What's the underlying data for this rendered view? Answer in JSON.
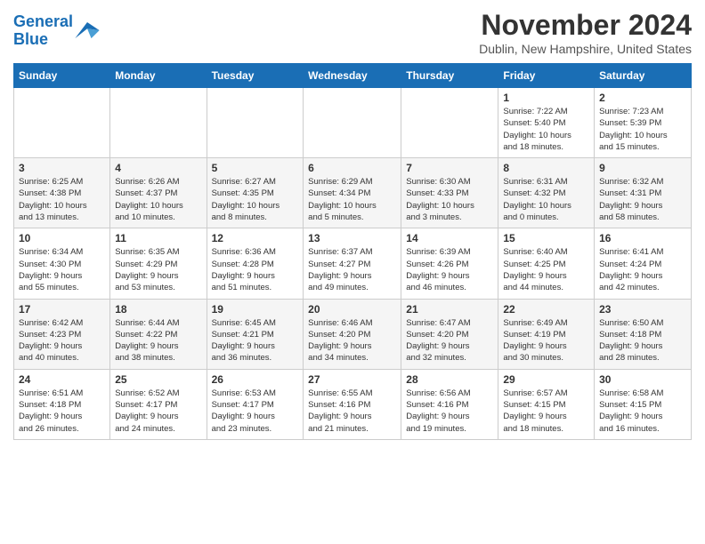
{
  "logo": {
    "line1": "General",
    "line2": "Blue"
  },
  "title": "November 2024",
  "location": "Dublin, New Hampshire, United States",
  "days_header": [
    "Sunday",
    "Monday",
    "Tuesday",
    "Wednesday",
    "Thursday",
    "Friday",
    "Saturday"
  ],
  "weeks": [
    [
      {
        "day": "",
        "info": ""
      },
      {
        "day": "",
        "info": ""
      },
      {
        "day": "",
        "info": ""
      },
      {
        "day": "",
        "info": ""
      },
      {
        "day": "",
        "info": ""
      },
      {
        "day": "1",
        "info": "Sunrise: 7:22 AM\nSunset: 5:40 PM\nDaylight: 10 hours\nand 18 minutes."
      },
      {
        "day": "2",
        "info": "Sunrise: 7:23 AM\nSunset: 5:39 PM\nDaylight: 10 hours\nand 15 minutes."
      }
    ],
    [
      {
        "day": "3",
        "info": "Sunrise: 6:25 AM\nSunset: 4:38 PM\nDaylight: 10 hours\nand 13 minutes."
      },
      {
        "day": "4",
        "info": "Sunrise: 6:26 AM\nSunset: 4:37 PM\nDaylight: 10 hours\nand 10 minutes."
      },
      {
        "day": "5",
        "info": "Sunrise: 6:27 AM\nSunset: 4:35 PM\nDaylight: 10 hours\nand 8 minutes."
      },
      {
        "day": "6",
        "info": "Sunrise: 6:29 AM\nSunset: 4:34 PM\nDaylight: 10 hours\nand 5 minutes."
      },
      {
        "day": "7",
        "info": "Sunrise: 6:30 AM\nSunset: 4:33 PM\nDaylight: 10 hours\nand 3 minutes."
      },
      {
        "day": "8",
        "info": "Sunrise: 6:31 AM\nSunset: 4:32 PM\nDaylight: 10 hours\nand 0 minutes."
      },
      {
        "day": "9",
        "info": "Sunrise: 6:32 AM\nSunset: 4:31 PM\nDaylight: 9 hours\nand 58 minutes."
      }
    ],
    [
      {
        "day": "10",
        "info": "Sunrise: 6:34 AM\nSunset: 4:30 PM\nDaylight: 9 hours\nand 55 minutes."
      },
      {
        "day": "11",
        "info": "Sunrise: 6:35 AM\nSunset: 4:29 PM\nDaylight: 9 hours\nand 53 minutes."
      },
      {
        "day": "12",
        "info": "Sunrise: 6:36 AM\nSunset: 4:28 PM\nDaylight: 9 hours\nand 51 minutes."
      },
      {
        "day": "13",
        "info": "Sunrise: 6:37 AM\nSunset: 4:27 PM\nDaylight: 9 hours\nand 49 minutes."
      },
      {
        "day": "14",
        "info": "Sunrise: 6:39 AM\nSunset: 4:26 PM\nDaylight: 9 hours\nand 46 minutes."
      },
      {
        "day": "15",
        "info": "Sunrise: 6:40 AM\nSunset: 4:25 PM\nDaylight: 9 hours\nand 44 minutes."
      },
      {
        "day": "16",
        "info": "Sunrise: 6:41 AM\nSunset: 4:24 PM\nDaylight: 9 hours\nand 42 minutes."
      }
    ],
    [
      {
        "day": "17",
        "info": "Sunrise: 6:42 AM\nSunset: 4:23 PM\nDaylight: 9 hours\nand 40 minutes."
      },
      {
        "day": "18",
        "info": "Sunrise: 6:44 AM\nSunset: 4:22 PM\nDaylight: 9 hours\nand 38 minutes."
      },
      {
        "day": "19",
        "info": "Sunrise: 6:45 AM\nSunset: 4:21 PM\nDaylight: 9 hours\nand 36 minutes."
      },
      {
        "day": "20",
        "info": "Sunrise: 6:46 AM\nSunset: 4:20 PM\nDaylight: 9 hours\nand 34 minutes."
      },
      {
        "day": "21",
        "info": "Sunrise: 6:47 AM\nSunset: 4:20 PM\nDaylight: 9 hours\nand 32 minutes."
      },
      {
        "day": "22",
        "info": "Sunrise: 6:49 AM\nSunset: 4:19 PM\nDaylight: 9 hours\nand 30 minutes."
      },
      {
        "day": "23",
        "info": "Sunrise: 6:50 AM\nSunset: 4:18 PM\nDaylight: 9 hours\nand 28 minutes."
      }
    ],
    [
      {
        "day": "24",
        "info": "Sunrise: 6:51 AM\nSunset: 4:18 PM\nDaylight: 9 hours\nand 26 minutes."
      },
      {
        "day": "25",
        "info": "Sunrise: 6:52 AM\nSunset: 4:17 PM\nDaylight: 9 hours\nand 24 minutes."
      },
      {
        "day": "26",
        "info": "Sunrise: 6:53 AM\nSunset: 4:17 PM\nDaylight: 9 hours\nand 23 minutes."
      },
      {
        "day": "27",
        "info": "Sunrise: 6:55 AM\nSunset: 4:16 PM\nDaylight: 9 hours\nand 21 minutes."
      },
      {
        "day": "28",
        "info": "Sunrise: 6:56 AM\nSunset: 4:16 PM\nDaylight: 9 hours\nand 19 minutes."
      },
      {
        "day": "29",
        "info": "Sunrise: 6:57 AM\nSunset: 4:15 PM\nDaylight: 9 hours\nand 18 minutes."
      },
      {
        "day": "30",
        "info": "Sunrise: 6:58 AM\nSunset: 4:15 PM\nDaylight: 9 hours\nand 16 minutes."
      }
    ]
  ]
}
